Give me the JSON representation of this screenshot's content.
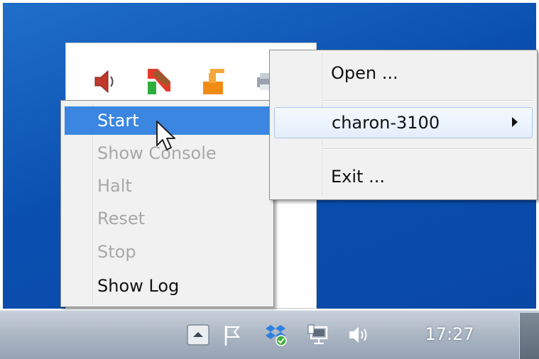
{
  "colors": {
    "desktop": "#0a4fb0",
    "selection": "#3a86e0",
    "disabled_text": "#a8a8a8",
    "menu_background": "#f1f1f1",
    "taskbar": "#a9b4c2"
  },
  "tray_popup": {
    "icons": [
      "speaker-icon",
      "charon-config-icon",
      "charon-launcher-icon",
      "printer-icon"
    ]
  },
  "instance_menu": {
    "items": [
      {
        "label": "Start",
        "enabled": true,
        "selected": true
      },
      {
        "label": "Show Console",
        "enabled": false
      },
      {
        "label": "Halt",
        "enabled": false
      },
      {
        "label": "Reset",
        "enabled": false
      },
      {
        "label": "Stop",
        "enabled": false
      },
      {
        "label": "Show Log",
        "enabled": true
      }
    ]
  },
  "main_menu": {
    "open_label": "Open ...",
    "instance_label": "charon-3100",
    "exit_label": "Exit ..."
  },
  "taskbar": {
    "clock": "17:27",
    "icons": [
      "show-hidden-icons-button",
      "action-center-flag-icon",
      "dropbox-icon",
      "network-icon",
      "volume-icon"
    ]
  }
}
